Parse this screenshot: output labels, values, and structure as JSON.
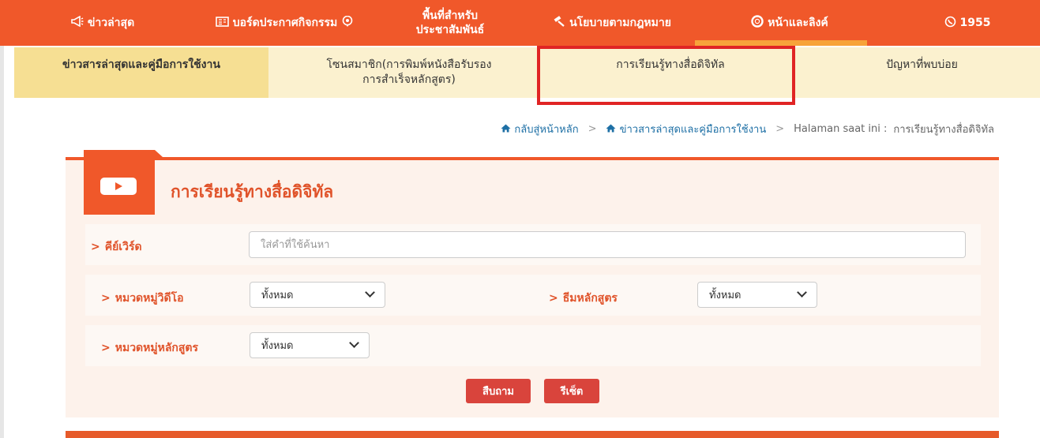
{
  "topnav": {
    "items": [
      {
        "label": "ข่าวล่าสุด",
        "icon": "megaphone-icon"
      },
      {
        "label": "บอร์ดประกาศกิจกรรม",
        "icon": "board-icon",
        "icon_after": "chat-bubble-icon"
      },
      {
        "line1": "พื้นที่สำหรับ",
        "line2": "ประชาสัมพันธ์"
      },
      {
        "label": "นโยบายตามกฎหมาย",
        "icon": "gavel-icon"
      },
      {
        "label": "หน้าและลิงค์",
        "icon": "lifebuoy-icon"
      },
      {
        "label": "1955",
        "icon": "phone-icon"
      }
    ],
    "active_index": 4
  },
  "subnav": {
    "items": [
      {
        "label": "ข่าวสารล่าสุดและคู่มือการใช้งาน"
      },
      {
        "line1": "โซนสมาชิก(การพิมพ์หนังสือรับรอง",
        "line2": "การสำเร็จหลักสูตร)"
      },
      {
        "label": "การเรียนรู้ทางสื่อดิจิทัล"
      },
      {
        "label": "ปัญหาที่พบบ่อย"
      }
    ],
    "active_index": 0,
    "highlighted_index": 2
  },
  "breadcrumb": {
    "home": "กลับสู่หน้าหลัก",
    "section": "ข่าวสารล่าสุดและคู่มือการใช้งาน",
    "current_prefix": "Halaman saat ini :",
    "current": "การเรียนรู้ทางสื่อดิจิทัล",
    "separator": ">"
  },
  "panel": {
    "title": "การเรียนรู้ทางสื่อดิจิทัล",
    "icon": "youtube-play-icon"
  },
  "search": {
    "keyword_label": "คีย์เวิร์ด",
    "keyword_placeholder": "ใส่คำที่ใช้ค้นหา",
    "video_category_label": "หมวดหมู่วิดีโอ",
    "video_category_value": "ทั้งหมด",
    "theme_label": "ธีมหลักสูตร",
    "theme_value": "ทั้งหมด",
    "course_category_label": "หมวดหมู่หลักสูตร",
    "course_category_value": "ทั้งหมด",
    "chevron": ">"
  },
  "buttons": {
    "search": "สืบถาม",
    "reset": "รีเซ็ต"
  },
  "colors": {
    "brand_orange": "#f0582a",
    "active_underline": "#f7a33a",
    "subnav_bg": "#fbf1cf",
    "highlight_red": "#e02424",
    "button_red": "#d9443c"
  }
}
